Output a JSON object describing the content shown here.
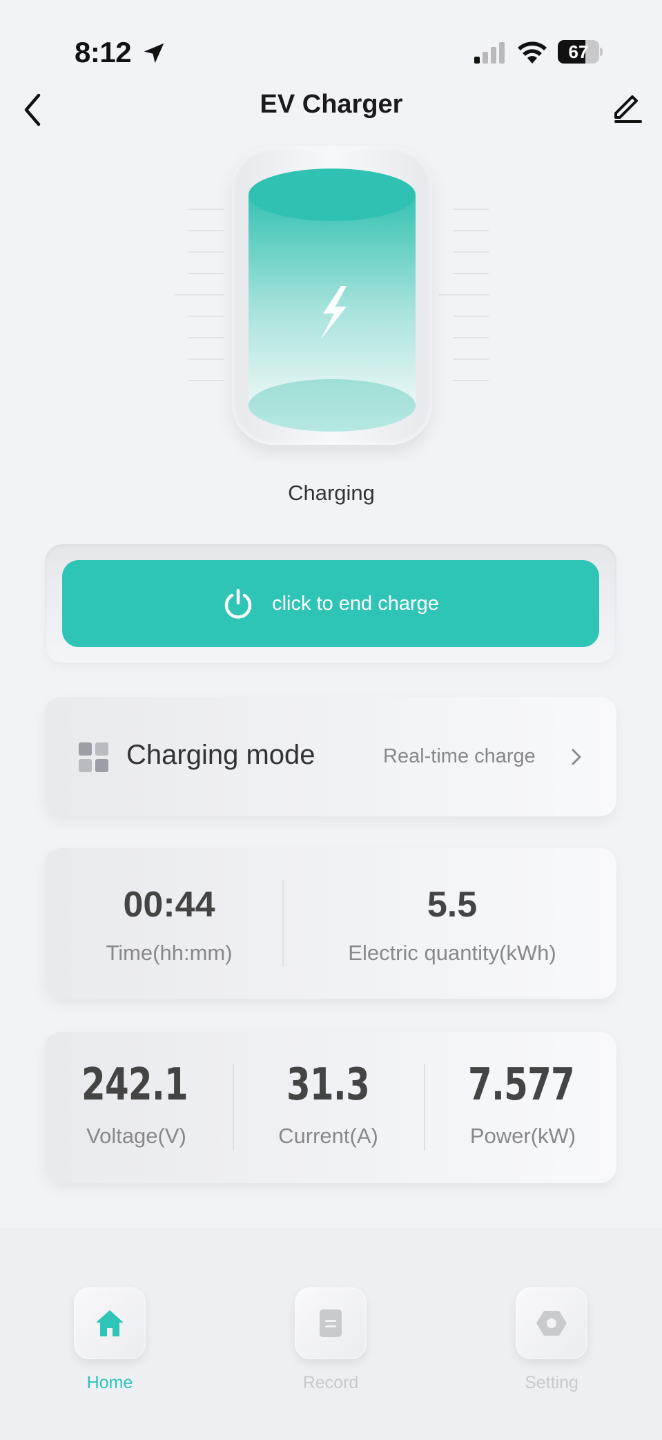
{
  "status_bar": {
    "time": "8:12",
    "battery": "67",
    "battery_level": 0.67
  },
  "header": {
    "title": "EV Charger"
  },
  "charger": {
    "status": "Charging"
  },
  "end_charge": {
    "label": "click to end charge"
  },
  "charging_mode": {
    "label": "Charging mode",
    "value": "Real-time charge"
  },
  "stats_primary": [
    {
      "value": "00:44",
      "label": "Time(hh:mm)"
    },
    {
      "value": "5.5",
      "label": "Electric quantity(kWh)"
    }
  ],
  "stats_secondary": [
    {
      "value": "242.1",
      "label": "Voltage(V)"
    },
    {
      "value": "31.3",
      "label": "Current(A)"
    },
    {
      "value": "7.577",
      "label": "Power(kW)"
    }
  ],
  "tab_bar": {
    "tabs": [
      {
        "label": "Home",
        "icon": "home-icon",
        "active": true
      },
      {
        "label": "Record",
        "icon": "record-icon",
        "active": false
      },
      {
        "label": "Setting",
        "icon": "setting-icon",
        "active": false
      }
    ]
  },
  "colors": {
    "accent": "#2ec4b6",
    "inactive": "#c9cacd",
    "background": "#f2f3f7"
  }
}
